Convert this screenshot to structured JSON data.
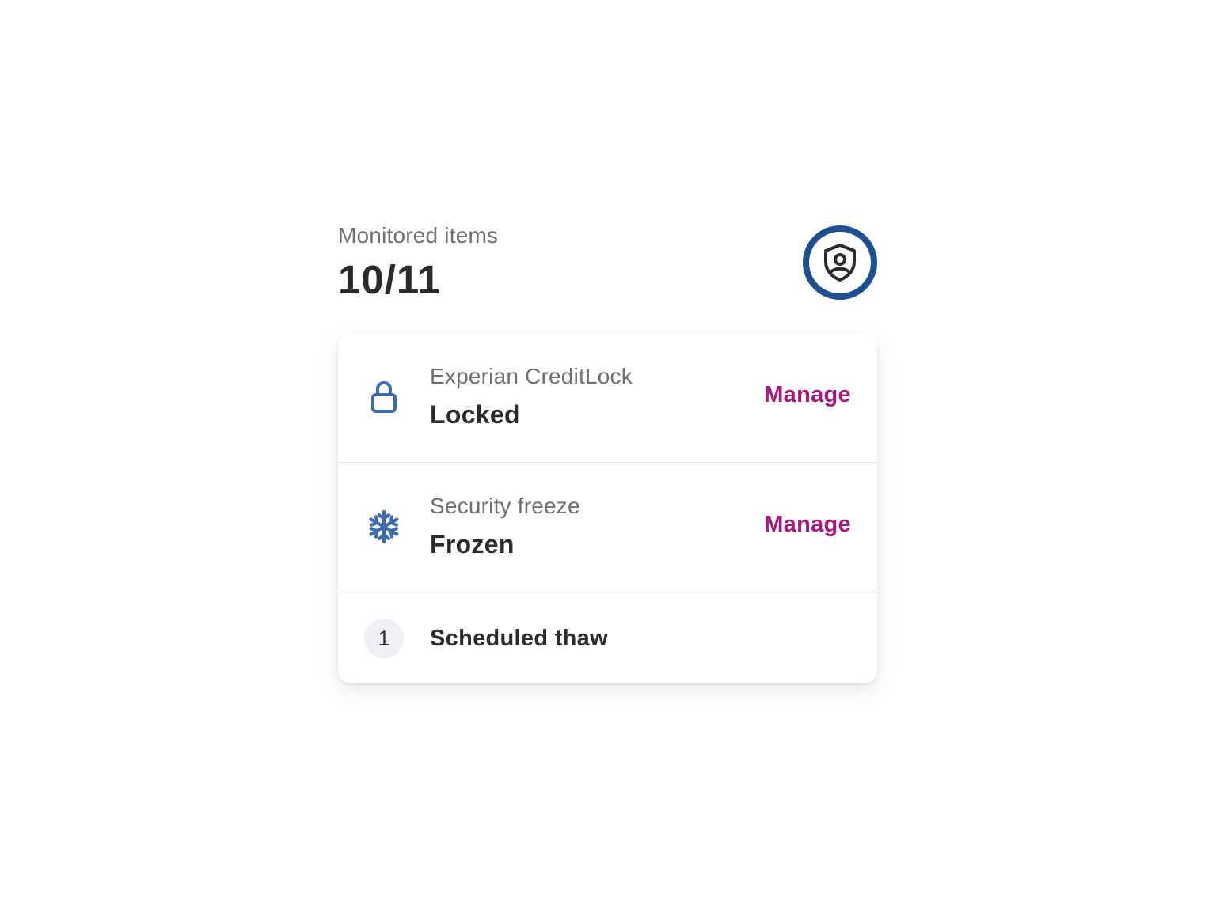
{
  "header": {
    "label": "Monitored items",
    "count": "10/11",
    "badge_icon": "shield-user-icon"
  },
  "items": [
    {
      "icon": "lock-icon",
      "subtitle": "Experian CreditLock",
      "status": "Locked",
      "action_label": "Manage"
    },
    {
      "icon": "snowflake-icon",
      "subtitle": "Security freeze",
      "status": "Frozen",
      "action_label": "Manage"
    }
  ],
  "scheduled": {
    "count": "1",
    "label": "Scheduled thaw"
  },
  "colors": {
    "accent_blue": "#1d4f91",
    "icon_blue": "#3b6bb0",
    "link_magenta": "#a3197e",
    "text_dark": "#2b2b2b",
    "text_muted": "#6f6f6f"
  }
}
